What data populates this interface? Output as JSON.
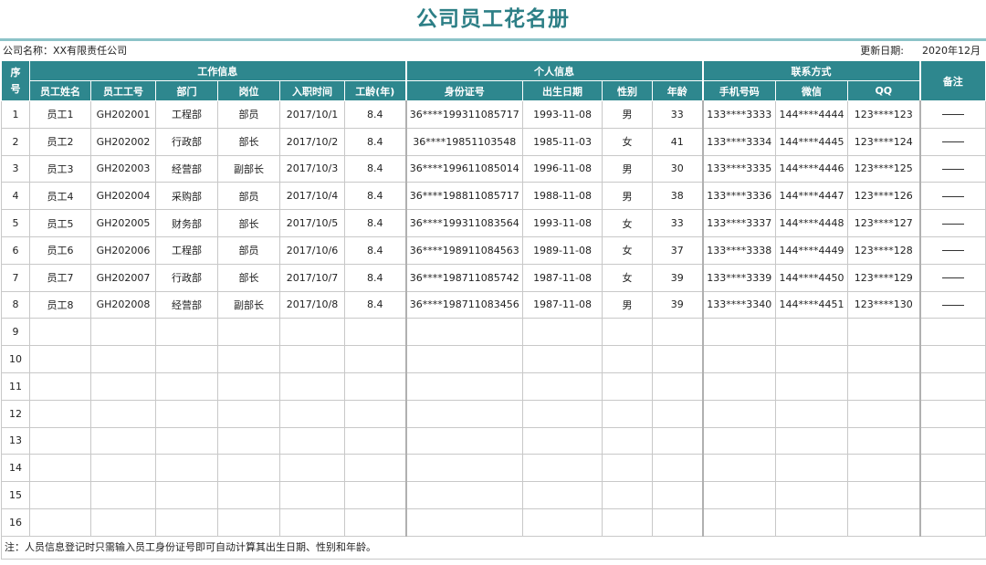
{
  "title": "公司员工花名册",
  "company_label": "公司名称：XX有限责任公司",
  "update_label": "更新日期:",
  "update_value": "2020年12月",
  "headers": {
    "seq": "序号",
    "group_work": "工作信息",
    "group_personal": "个人信息",
    "group_contact": "联系方式",
    "remark": "备注",
    "name": "员工姓名",
    "emp_no": "员工工号",
    "dept": "部门",
    "position": "岗位",
    "join_date": "入职时间",
    "tenure": "工龄(年)",
    "id_no": "身份证号",
    "birth": "出生日期",
    "gender": "性别",
    "age": "年龄",
    "phone": "手机号码",
    "wechat": "微信",
    "qq": "QQ"
  },
  "rows": [
    {
      "seq": "1",
      "name": "员工1",
      "emp_no": "GH202001",
      "dept": "工程部",
      "position": "部员",
      "join_date": "2017/10/1",
      "tenure": "8.4",
      "id_no": "36****199311085717",
      "birth": "1993-11-08",
      "gender": "男",
      "age": "33",
      "phone": "133****3333",
      "wechat": "144****4444",
      "qq": "123****123"
    },
    {
      "seq": "2",
      "name": "员工2",
      "emp_no": "GH202002",
      "dept": "行政部",
      "position": "部长",
      "join_date": "2017/10/2",
      "tenure": "8.4",
      "id_no": "36****19851103548",
      "birth": "1985-11-03",
      "gender": "女",
      "age": "41",
      "phone": "133****3334",
      "wechat": "144****4445",
      "qq": "123****124"
    },
    {
      "seq": "3",
      "name": "员工3",
      "emp_no": "GH202003",
      "dept": "经营部",
      "position": "副部长",
      "join_date": "2017/10/3",
      "tenure": "8.4",
      "id_no": "36****199611085014",
      "birth": "1996-11-08",
      "gender": "男",
      "age": "30",
      "phone": "133****3335",
      "wechat": "144****4446",
      "qq": "123****125"
    },
    {
      "seq": "4",
      "name": "员工4",
      "emp_no": "GH202004",
      "dept": "采购部",
      "position": "部员",
      "join_date": "2017/10/4",
      "tenure": "8.4",
      "id_no": "36****198811085717",
      "birth": "1988-11-08",
      "gender": "男",
      "age": "38",
      "phone": "133****3336",
      "wechat": "144****4447",
      "qq": "123****126"
    },
    {
      "seq": "5",
      "name": "员工5",
      "emp_no": "GH202005",
      "dept": "财务部",
      "position": "部长",
      "join_date": "2017/10/5",
      "tenure": "8.4",
      "id_no": "36****199311083564",
      "birth": "1993-11-08",
      "gender": "女",
      "age": "33",
      "phone": "133****3337",
      "wechat": "144****4448",
      "qq": "123****127"
    },
    {
      "seq": "6",
      "name": "员工6",
      "emp_no": "GH202006",
      "dept": "工程部",
      "position": "部员",
      "join_date": "2017/10/6",
      "tenure": "8.4",
      "id_no": "36****198911084563",
      "birth": "1989-11-08",
      "gender": "女",
      "age": "37",
      "phone": "133****3338",
      "wechat": "144****4449",
      "qq": "123****128"
    },
    {
      "seq": "7",
      "name": "员工7",
      "emp_no": "GH202007",
      "dept": "行政部",
      "position": "部长",
      "join_date": "2017/10/7",
      "tenure": "8.4",
      "id_no": "36****198711085742",
      "birth": "1987-11-08",
      "gender": "女",
      "age": "39",
      "phone": "133****3339",
      "wechat": "144****4450",
      "qq": "123****129"
    },
    {
      "seq": "8",
      "name": "员工8",
      "emp_no": "GH202008",
      "dept": "经营部",
      "position": "副部长",
      "join_date": "2017/10/8",
      "tenure": "8.4",
      "id_no": "36****198711083456",
      "birth": "1987-11-08",
      "gender": "男",
      "age": "39",
      "phone": "133****3340",
      "wechat": "144****4451",
      "qq": "123****130"
    },
    {
      "seq": "9"
    },
    {
      "seq": "10"
    },
    {
      "seq": "11"
    },
    {
      "seq": "12"
    },
    {
      "seq": "13"
    },
    {
      "seq": "14"
    },
    {
      "seq": "15"
    },
    {
      "seq": "16"
    }
  ],
  "note": "注：人员信息登记时只需输入员工身份证号即可自动计算其出生日期、性别和年龄。",
  "colors": {
    "header_bg": "#2e878e",
    "title": "#2d7f86"
  }
}
